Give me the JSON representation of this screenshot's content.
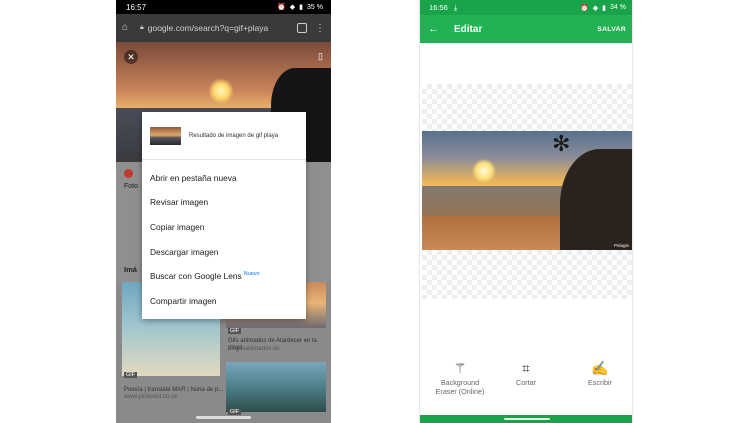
{
  "left": {
    "status_time": "16:57",
    "status_battery": "35 %",
    "url": "google.com/search?q=gif+playa",
    "result_prefix": "Foto",
    "images_heading": "Imá",
    "dialog": {
      "header": "Resultado de imagen de gif playa",
      "items": [
        "Abrir en pestaña nueva",
        "Revisar imagen",
        "Copiar imagen",
        "Descargar imagen",
        "Buscar con Google Lens",
        "Compartir imagen"
      ],
      "new_badge": "Nuevo"
    },
    "thumbs": [
      {
        "tag": "GIF",
        "caption": "Poesía | translate MAR | Nuria de p...",
        "source": "www.pinterest.co.uk"
      },
      {
        "tag": "GIF",
        "caption": "Gifs animados de Atardecer en la playa",
        "source": "es.gifsanimados.de"
      },
      {
        "tag": "GIF"
      }
    ]
  },
  "right": {
    "status_time": "16:56",
    "status_battery": "34 %",
    "toolbar_title": "Editar",
    "save_label": "SALVAR",
    "watermark": "Pelagie",
    "tools": [
      {
        "icon": "magic-wand-icon",
        "label": "Background Eraser (Online)"
      },
      {
        "icon": "crop-icon",
        "label": "Cortar"
      },
      {
        "icon": "write-icon",
        "label": "Escribir"
      }
    ]
  },
  "colors": {
    "brand_green": "#22b153",
    "status_green": "#1aa44a",
    "new_badge_blue": "#1a73e8"
  }
}
